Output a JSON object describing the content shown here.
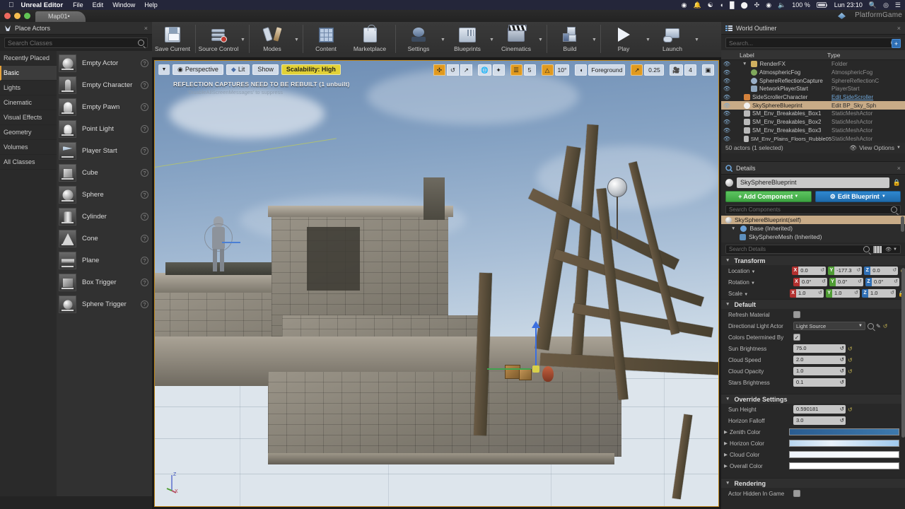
{
  "macbar": {
    "app": "Unreal Editor",
    "menus": [
      "File",
      "Edit",
      "Window",
      "Help"
    ],
    "battery": "100 %",
    "clock": "Lun 23:10",
    "status_icons": [
      "record-icon",
      "notification-icon",
      "docker-icon",
      "colorpicker-icon",
      "evernote-icon",
      "drop-icon",
      "movemouse-icon",
      "wifi-icon",
      "volume-icon",
      "battery-icon",
      "spotlight-icon",
      "siri-icon",
      "controlcenter-icon"
    ]
  },
  "titlebar": {
    "tab": "Map01•",
    "project": "PlatformGame"
  },
  "toolbar": {
    "items": [
      {
        "label": "Save Current",
        "icon": "save-icon",
        "dropdown": false
      },
      {
        "label": "Source Control",
        "icon": "source-control-icon",
        "dropdown": true
      },
      {
        "label": "Modes",
        "icon": "modes-icon",
        "dropdown": true
      },
      {
        "label": "Content",
        "icon": "content-icon",
        "dropdown": false
      },
      {
        "label": "Marketplace",
        "icon": "marketplace-icon",
        "dropdown": false
      },
      {
        "label": "Settings",
        "icon": "settings-gear-icon",
        "dropdown": true
      },
      {
        "label": "Blueprints",
        "icon": "blueprints-icon",
        "dropdown": true
      },
      {
        "label": "Cinematics",
        "icon": "cinematics-icon",
        "dropdown": true
      },
      {
        "label": "Build",
        "icon": "build-icon",
        "dropdown": true
      },
      {
        "label": "Play",
        "icon": "play-icon",
        "dropdown": true
      },
      {
        "label": "Launch",
        "icon": "launch-icon",
        "dropdown": true
      }
    ]
  },
  "place_actors": {
    "title": "Place Actors",
    "search_placeholder": "Search Classes",
    "categories": [
      {
        "label": "Recently Placed",
        "selected": false
      },
      {
        "label": "Basic",
        "selected": true
      },
      {
        "label": "Lights",
        "selected": false
      },
      {
        "label": "Cinematic",
        "selected": false
      },
      {
        "label": "Visual Effects",
        "selected": false
      },
      {
        "label": "Geometry",
        "selected": false
      },
      {
        "label": "Volumes",
        "selected": false
      },
      {
        "label": "All Classes",
        "selected": false
      }
    ],
    "actors": [
      {
        "label": "Empty Actor",
        "icon": "sphere-thumb-icon"
      },
      {
        "label": "Empty Character",
        "icon": "character-thumb-icon"
      },
      {
        "label": "Empty Pawn",
        "icon": "pawn-thumb-icon"
      },
      {
        "label": "Point Light",
        "icon": "bulb-thumb-icon"
      },
      {
        "label": "Player Start",
        "icon": "flag-thumb-icon"
      },
      {
        "label": "Cube",
        "icon": "cube-thumb-icon"
      },
      {
        "label": "Sphere",
        "icon": "sphere-thumb-icon"
      },
      {
        "label": "Cylinder",
        "icon": "cylinder-thumb-icon"
      },
      {
        "label": "Cone",
        "icon": "cone-thumb-icon"
      },
      {
        "label": "Plane",
        "icon": "plane-thumb-icon"
      },
      {
        "label": "Box Trigger",
        "icon": "box-trigger-thumb-icon"
      },
      {
        "label": "Sphere Trigger",
        "icon": "sphere-trigger-thumb-icon"
      }
    ]
  },
  "viewport": {
    "warning_line1": "REFLECTION CAPTURES NEED TO BE REBUILT (1 unbuilt)",
    "warning_line2": "'DisableAllScreenMessages' to suppress",
    "view_mode": "Perspective",
    "lighting_mode": "Lit",
    "show_menu": "Show",
    "scalability": "Scalability: High",
    "grid_snap": "5",
    "angle_snap": "10°",
    "scale_snap": "0.25",
    "camera_speed": "4",
    "layer": "Foreground",
    "accent_selection": "#c08a1e"
  },
  "world_outliner": {
    "title": "World Outliner",
    "search_placeholder": "Search...",
    "columns": {
      "label": "Label",
      "type": "Type"
    },
    "rows": [
      {
        "label": "RenderFX",
        "type": "Folder",
        "indent": 1,
        "icon": "folder-icon",
        "selected": false,
        "link": false
      },
      {
        "label": "AtmosphericFog",
        "type": "AtmosphericFog",
        "indent": 2,
        "icon": "fog-icon",
        "selected": false,
        "link": false
      },
      {
        "label": "SphereReflectionCapture",
        "type": "SphereReflectionC",
        "indent": 2,
        "icon": "reflection-icon",
        "selected": false,
        "link": false
      },
      {
        "label": "NetworkPlayerStart",
        "type": "PlayerStart",
        "indent": 2,
        "icon": "playerstart-icon",
        "selected": false,
        "link": false
      },
      {
        "label": "SideScrollerCharacter",
        "type": "Edit SideScroller",
        "indent": 1,
        "icon": "character-icon",
        "selected": false,
        "link": true
      },
      {
        "label": "SkySphereBlueprint",
        "type": "Edit BP_Sky_Sph",
        "indent": 1,
        "icon": "sphere-icon",
        "selected": true,
        "link": true
      },
      {
        "label": "SM_Env_Breakables_Box1",
        "type": "StaticMeshActor",
        "indent": 1,
        "icon": "mesh-icon",
        "selected": false,
        "link": false
      },
      {
        "label": "SM_Env_Breakables_Box2",
        "type": "StaticMeshActor",
        "indent": 1,
        "icon": "mesh-icon",
        "selected": false,
        "link": false
      },
      {
        "label": "SM_Env_Breakables_Box3",
        "type": "StaticMeshActor",
        "indent": 1,
        "icon": "mesh-icon",
        "selected": false,
        "link": false
      },
      {
        "label": "SM_Env_Plains_Floors_Rubble05",
        "type": "StaticMeshActor",
        "indent": 1,
        "icon": "mesh-icon",
        "selected": false,
        "link": false
      }
    ],
    "footer_count": "50 actors (1 selected)",
    "view_options": "View Options"
  },
  "details": {
    "title": "Details",
    "actor_name": "SkySphereBlueprint",
    "add_component": "Add Component",
    "edit_blueprint": "Edit Blueprint",
    "components_search_placeholder": "Search Components",
    "components": [
      {
        "label": "SkySphereBlueprint(self)",
        "indent": 0,
        "selected": true
      },
      {
        "label": "Base (Inherited)",
        "indent": 1,
        "selected": false
      },
      {
        "label": "SkySphereMesh (Inherited)",
        "indent": 2,
        "selected": false
      }
    ],
    "details_search_placeholder": "Search Details",
    "sections": [
      {
        "title": "Transform",
        "rows": [
          {
            "label": "Location",
            "type": "vector",
            "x": "0.0",
            "y": "-177.3",
            "z": "0.0",
            "reset": true
          },
          {
            "label": "Rotation",
            "type": "vector",
            "x": "0.0°",
            "y": "0.0°",
            "z": "0.0°",
            "reset": false
          },
          {
            "label": "Scale",
            "type": "vector",
            "x": "1.0",
            "y": "1.0",
            "z": "1.0",
            "lock": true
          }
        ]
      },
      {
        "title": "Default",
        "rows": [
          {
            "label": "Refresh Material",
            "type": "checkbox",
            "checked": false
          },
          {
            "label": "Directional Light Actor",
            "type": "combo",
            "value": "Light Source"
          },
          {
            "label": "Colors Determined By",
            "type": "checkbox",
            "checked": true
          },
          {
            "label": "Sun Brightness",
            "type": "number",
            "value": "75.0",
            "reset": true
          },
          {
            "label": "Cloud Speed",
            "type": "number",
            "value": "2.0",
            "reset": true
          },
          {
            "label": "Cloud Opacity",
            "type": "number",
            "value": "1.0",
            "reset": true
          },
          {
            "label": "Stars Brightness",
            "type": "number",
            "value": "0.1",
            "reset": false
          }
        ]
      },
      {
        "title": "Override Settings",
        "rows": [
          {
            "label": "Sun Height",
            "type": "number",
            "value": "0.590181",
            "reset": true
          },
          {
            "label": "Horizon Falloff",
            "type": "number",
            "value": "3.0",
            "reset": false
          },
          {
            "label": "Zenith Color",
            "type": "color",
            "value": "#2f6395",
            "expandable": true
          },
          {
            "label": "Horizon Color",
            "type": "color",
            "value": "#bcd9f2",
            "expandable": true
          },
          {
            "label": "Cloud Color",
            "type": "color",
            "value": "#eef4fb",
            "expandable": true
          },
          {
            "label": "Overall Color",
            "type": "color",
            "value": "#ffffff",
            "expandable": true
          }
        ]
      },
      {
        "title": "Rendering",
        "rows": [
          {
            "label": "Actor Hidden In Game",
            "type": "checkbox",
            "checked": false
          }
        ]
      }
    ]
  }
}
